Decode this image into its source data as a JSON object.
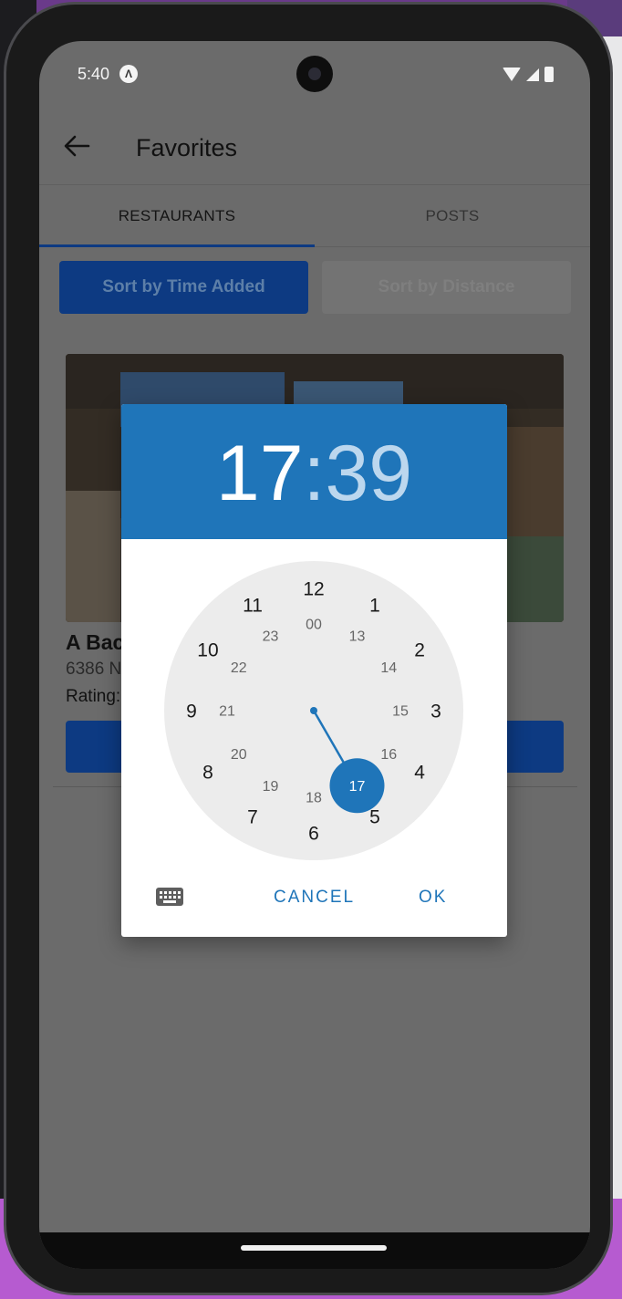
{
  "status_bar": {
    "time": "5:40",
    "app_icon_glyph": "Λ"
  },
  "header": {
    "title": "Favorites"
  },
  "tabs": [
    {
      "label": "RESTAURANTS",
      "active": true
    },
    {
      "label": "POSTS",
      "active": false
    }
  ],
  "sort": {
    "time_added_label": "Sort by Time Added",
    "distance_label": "Sort by Distance"
  },
  "restaurant_card": {
    "name": "A Bac",
    "address": "6386 N",
    "rating_label": "Rating:"
  },
  "time_picker": {
    "hour": "17",
    "separator": ":",
    "minute": "39",
    "selected_hour": 17,
    "outer_ring_hours": [
      "12",
      "1",
      "2",
      "3",
      "4",
      "5",
      "6",
      "7",
      "8",
      "9",
      "10",
      "11"
    ],
    "inner_ring_hours": [
      "00",
      "13",
      "14",
      "15",
      "16",
      "17",
      "18",
      "19",
      "20",
      "21",
      "22",
      "23"
    ],
    "cancel_label": "CANCEL",
    "ok_label": "OK",
    "accent_color": "#1f75b9"
  },
  "icons": {
    "back": "arrow-left-icon",
    "keyboard": "keyboard-icon",
    "wifi": "wifi-icon",
    "signal": "signal-icon",
    "battery": "battery-icon"
  }
}
